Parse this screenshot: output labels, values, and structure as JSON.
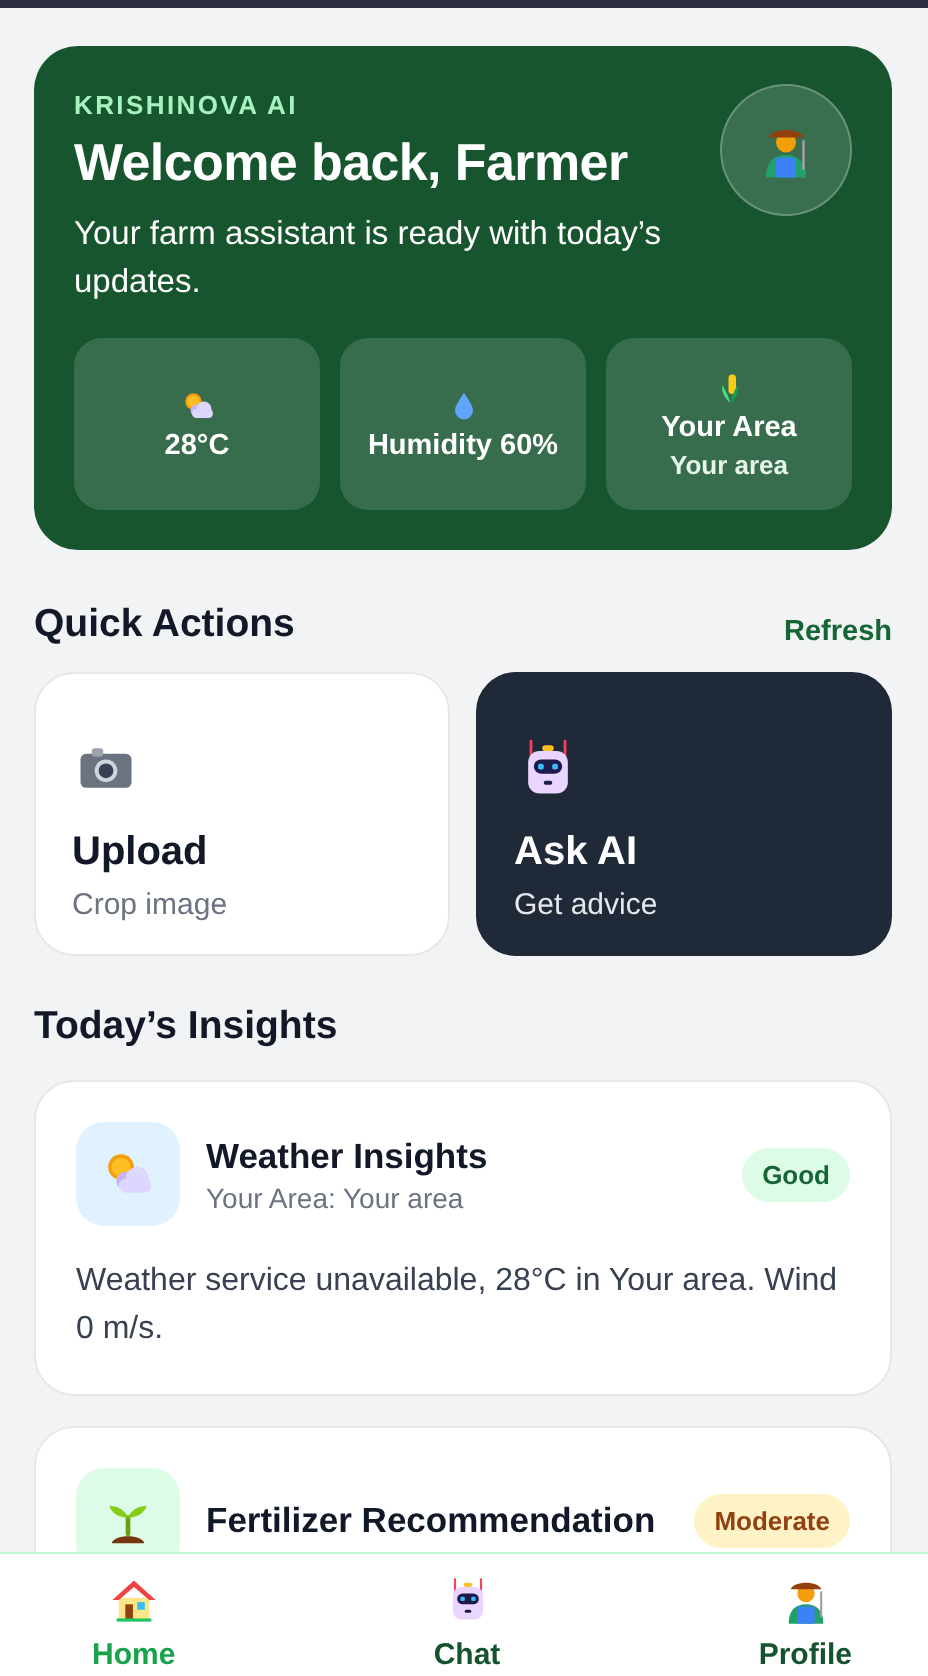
{
  "hero": {
    "brand": "KRISHINOVA AI",
    "title": "Welcome back, Farmer",
    "subtitle": "Your farm assistant is ready with today’s updates.",
    "stats": [
      {
        "label": "28°C"
      },
      {
        "label": "Humidity 60%"
      },
      {
        "label": "Your Area",
        "sublabel": "Your area"
      }
    ]
  },
  "quick_actions": {
    "title": "Quick Actions",
    "refresh": "Refresh",
    "items": [
      {
        "title": "Upload",
        "subtitle": "Crop image",
        "highlighted": false
      },
      {
        "title": "Ask AI",
        "subtitle": "Get advice",
        "highlighted": true
      }
    ]
  },
  "insights": {
    "title": "Today’s Insights",
    "items": [
      {
        "title": "Weather Insights",
        "subtitle": "Your Area: Your area",
        "badge": "Good",
        "kind": "good",
        "body": "Weather service unavailable, 28°C in Your area. Wind 0 m/s."
      },
      {
        "title": "Fertilizer Recommendation",
        "badge": "Moderate",
        "kind": "moderate"
      }
    ]
  },
  "bottom_nav": [
    {
      "label": "Home",
      "selected": true
    },
    {
      "label": "Chat",
      "selected": false
    },
    {
      "label": "Profile",
      "selected": false
    }
  ]
}
